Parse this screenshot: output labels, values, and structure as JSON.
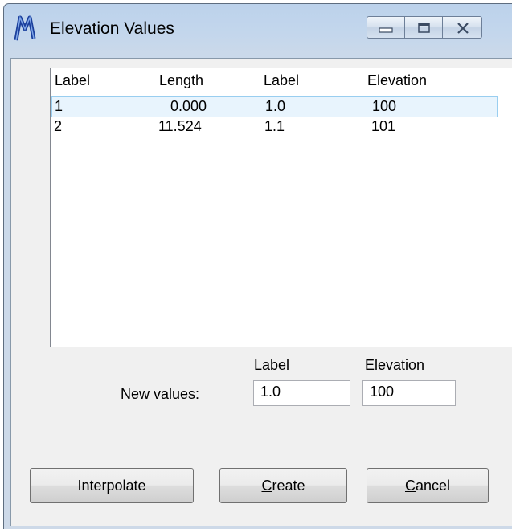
{
  "window": {
    "title": "Elevation Values"
  },
  "list": {
    "columns": [
      "Label",
      "Length",
      "Label",
      "Elevation"
    ],
    "rows": [
      {
        "label": "1",
        "length": "0.000",
        "label2": "1.0",
        "elevation": "100",
        "selected": true
      },
      {
        "label": "2",
        "length": "11.524",
        "label2": "1.1",
        "elevation": "101",
        "selected": false
      }
    ]
  },
  "new_values": {
    "label": "New values:",
    "label_header": "Label",
    "elevation_header": "Elevation",
    "label_value": "1.0",
    "elevation_value": "100"
  },
  "buttons": {
    "interpolate": "Interpolate",
    "create_first": "C",
    "create_rest": "reate",
    "cancel_first": "C",
    "cancel_rest": "ancel"
  },
  "icons": {
    "app": "microstation-m-icon",
    "minimize": "minimize-icon",
    "maximize": "maximize-icon",
    "close": "close-icon"
  }
}
